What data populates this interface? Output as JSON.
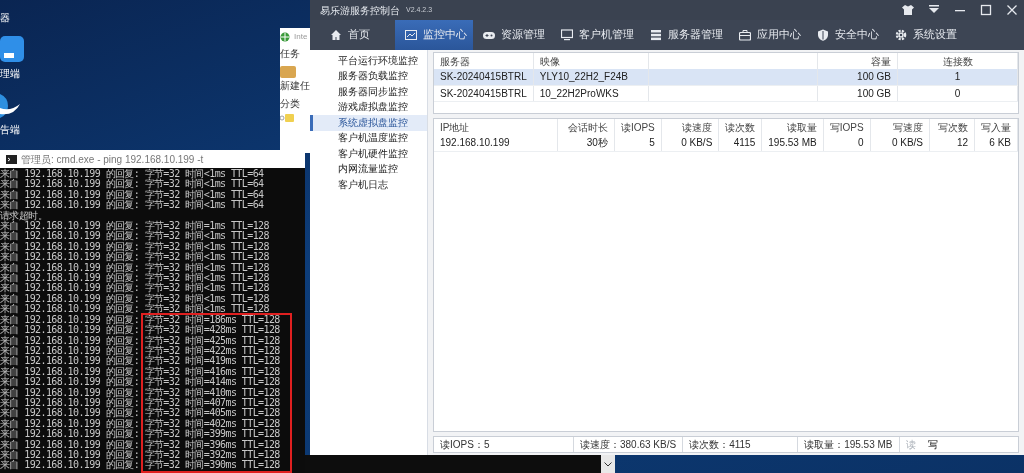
{
  "desktop": {
    "icons": [
      {
        "label": "器"
      },
      {
        "label": "理端"
      },
      {
        "label": "告端"
      }
    ]
  },
  "background_window": {
    "title": "Inte",
    "menu": "任务",
    "toolbar_button": "新建任",
    "panel_label": "分类"
  },
  "cmd_window": {
    "title": "管理员: cmd.exe - ping  192.168.10.199 -t",
    "lines": [
      "来自 192.168.10.199 的回复: 字节=32 时间<1ms TTL=64",
      "来自 192.168.10.199 的回复: 字节=32 时间<1ms TTL=64",
      "来自 192.168.10.199 的回复: 字节=32 时间<1ms TTL=64",
      "来自 192.168.10.199 的回复: 字节=32 时间<1ms TTL=64",
      "请求超时。",
      "来自 192.168.10.199 的回复: 字节=32 时间=1ms TTL=128",
      "来自 192.168.10.199 的回复: 字节=32 时间<1ms TTL=128",
      "来自 192.168.10.199 的回复: 字节=32 时间<1ms TTL=128",
      "来自 192.168.10.199 的回复: 字节=32 时间<1ms TTL=128",
      "来自 192.168.10.199 的回复: 字节=32 时间<1ms TTL=128",
      "来自 192.168.10.199 的回复: 字节=32 时间<1ms TTL=128",
      "来自 192.168.10.199 的回复: 字节=32 时间<1ms TTL=128",
      "来自 192.168.10.199 的回复: 字节=32 时间<1ms TTL=128",
      "来自 192.168.10.199 的回复: 字节=32 时间<1ms TTL=128",
      "来自 192.168.10.199 的回复: 字节=32 时间=186ms TTL=128",
      "来自 192.168.10.199 的回复: 字节=32 时间=428ms TTL=128",
      "来自 192.168.10.199 的回复: 字节=32 时间=425ms TTL=128",
      "来自 192.168.10.199 的回复: 字节=32 时间=422ms TTL=128",
      "来自 192.168.10.199 的回复: 字节=32 时间=419ms TTL=128",
      "来自 192.168.10.199 的回复: 字节=32 时间=416ms TTL=128",
      "来自 192.168.10.199 的回复: 字节=32 时间=414ms TTL=128",
      "来自 192.168.10.199 的回复: 字节=32 时间=410ms TTL=128",
      "来自 192.168.10.199 的回复: 字节=32 时间=407ms TTL=128",
      "来自 192.168.10.199 的回复: 字节=32 时间=405ms TTL=128",
      "来自 192.168.10.199 的回复: 字节=32 时间=402ms TTL=128",
      "来自 192.168.10.199 的回复: 字节=32 时间=399ms TTL=128",
      "来自 192.168.10.199 的回复: 字节=32 时间=396ms TTL=128",
      "来自 192.168.10.199 的回复: 字节=32 时间=392ms TTL=128",
      "来自 192.168.10.199 的回复: 字节=32 时间=390ms TTL=128"
    ]
  },
  "app": {
    "title": "易乐游服务控制台",
    "version": "V2.4.2.3",
    "nav": [
      {
        "label": "首页",
        "selected": false
      },
      {
        "label": "监控中心",
        "selected": true
      },
      {
        "label": "资源管理",
        "selected": false
      },
      {
        "label": "客户机管理",
        "selected": false
      },
      {
        "label": "服务器管理",
        "selected": false
      },
      {
        "label": "应用中心",
        "selected": false
      },
      {
        "label": "安全中心",
        "selected": false
      },
      {
        "label": "系统设置",
        "selected": false
      }
    ],
    "sidebar": [
      {
        "label": "平台运行环境监控",
        "selected": false
      },
      {
        "label": "服务器负载监控",
        "selected": false
      },
      {
        "label": "服务器同步监控",
        "selected": false
      },
      {
        "label": "游戏虚拟盘监控",
        "selected": false
      },
      {
        "label": "系统虚拟盘监控",
        "selected": true
      },
      {
        "label": "客户机温度监控",
        "selected": false
      },
      {
        "label": "客户机硬件监控",
        "selected": false
      },
      {
        "label": "内网流量监控",
        "selected": false
      },
      {
        "label": "客户机日志",
        "selected": false
      }
    ],
    "servers_table": {
      "columns": [
        "服务器",
        "映像",
        "容量",
        "连接数"
      ],
      "rows": [
        {
          "cells": [
            "SK-20240415BTRL",
            "YLY10_22H2_F24B",
            "100 GB",
            "1"
          ],
          "selected": true
        },
        {
          "cells": [
            "SK-20240415BTRL",
            "10_22H2ProWKS",
            "100 GB",
            "0"
          ],
          "selected": false
        }
      ]
    },
    "sessions_table": {
      "columns": [
        "IP地址",
        "会话时长",
        "读IOPS",
        "读速度",
        "读次数",
        "读取量",
        "写IOPS",
        "写速度",
        "写次数",
        "写入量"
      ],
      "rows": [
        {
          "cells": [
            "192.168.10.199",
            "30秒",
            "5",
            "0 KB/S",
            "4115",
            "195.53 MB",
            "0",
            "0 KB/S",
            "12",
            "6 KB"
          ]
        }
      ]
    },
    "status_bar": {
      "fields": [
        "读IOPS：5",
        "读速度：380.63 KB/S",
        "读次数：4115",
        "读取量：195.53 MB"
      ],
      "toggles": [
        {
          "label": "读",
          "enabled": false
        },
        {
          "label": "写",
          "enabled": true
        }
      ]
    }
  }
}
